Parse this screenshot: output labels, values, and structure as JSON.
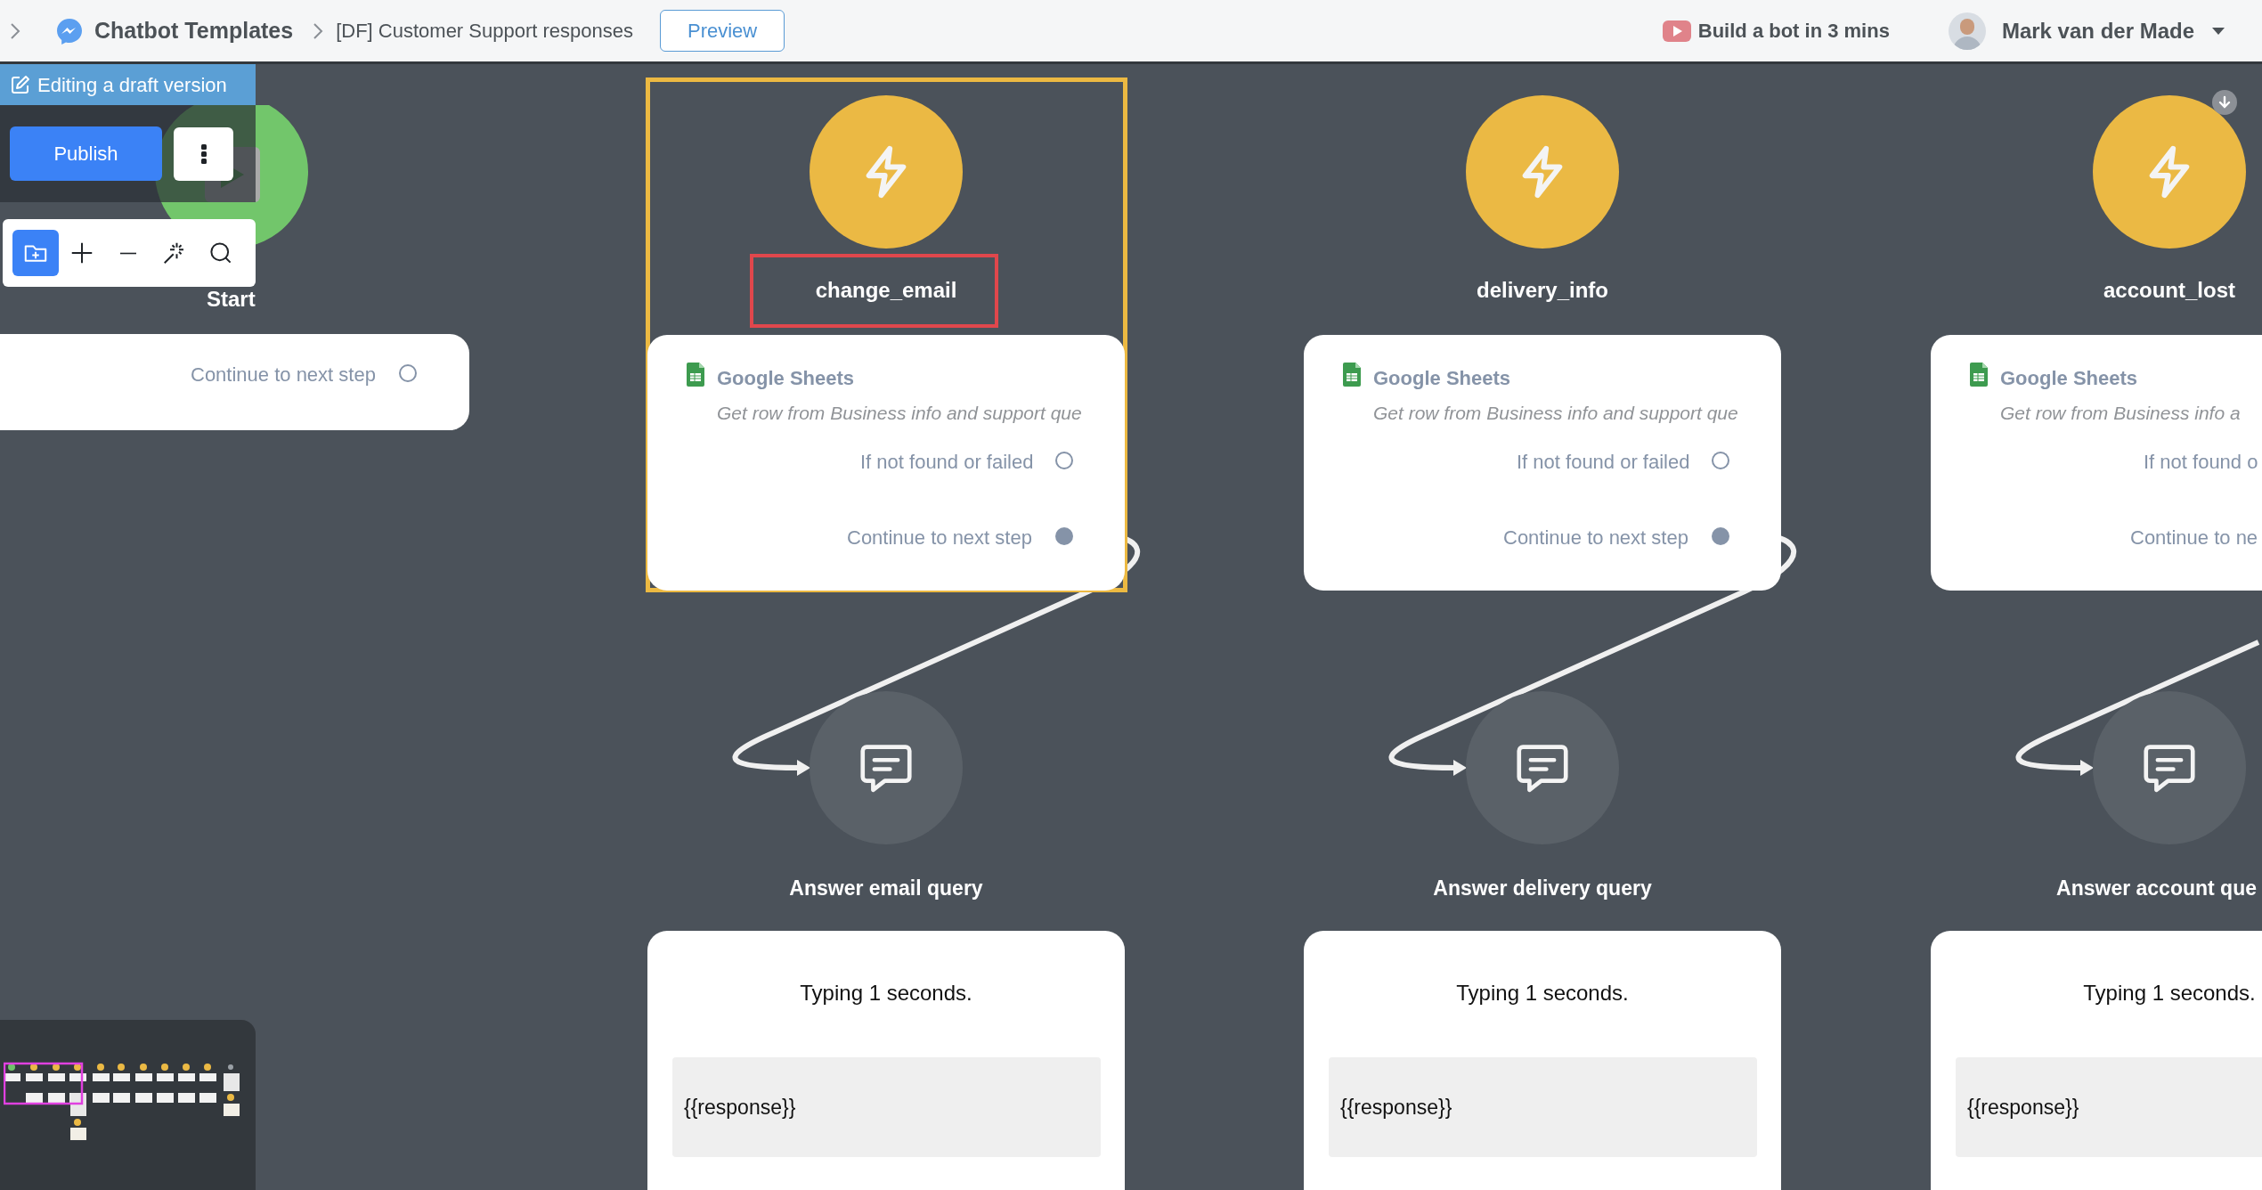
{
  "breadcrumb": [
    {
      "text": "Chatbot Templates"
    },
    {
      "text": "[DF] Customer Support responses"
    }
  ],
  "preview_button": "Preview",
  "tutorial_link": "Build a bot in 3 mins",
  "user": {
    "name": "Mark van der Made"
  },
  "draft_banner": "Editing a draft version",
  "publish_button": "Publish",
  "toolbar": [
    {
      "kind": "add-folder",
      "selected": true
    },
    {
      "kind": "zoom-in",
      "selected": false
    },
    {
      "kind": "zoom-out",
      "selected": false
    },
    {
      "kind": "auto-arrange",
      "selected": false
    },
    {
      "kind": "search",
      "selected": false
    }
  ],
  "start_node": {
    "title": "Start",
    "outputs": [
      {
        "label": "Continue to next step",
        "connected": false
      }
    ]
  },
  "flows": [
    {
      "selected": true,
      "trigger": {
        "title": "change_email",
        "highlighted": true
      },
      "action": {
        "service": "Google Sheets",
        "description": "Get row from Business info and support que",
        "outputs": [
          {
            "label": "If not found or failed",
            "connected": false
          },
          {
            "label": "Continue to next step",
            "connected": true
          }
        ]
      },
      "message": {
        "title": "Answer email query",
        "typing": "Typing 1 seconds.",
        "text": "{{response}}"
      }
    },
    {
      "selected": false,
      "trigger": {
        "title": "delivery_info",
        "highlighted": false
      },
      "action": {
        "service": "Google Sheets",
        "description": "Get row from Business info and support que",
        "outputs": [
          {
            "label": "If not found or failed",
            "connected": false
          },
          {
            "label": "Continue to next step",
            "connected": true
          }
        ]
      },
      "message": {
        "title": "Answer delivery query",
        "typing": "Typing 1 seconds.",
        "text": "{{response}}"
      }
    },
    {
      "selected": false,
      "trigger": {
        "title": "account_lost",
        "highlighted": false
      },
      "action": {
        "service": "Google Sheets",
        "description": "Get row from Business info a",
        "outputs": [
          {
            "label": "If not found o"
          },
          {
            "label": "Continue to ne"
          }
        ]
      },
      "message": {
        "title": "Answer account que",
        "typing": "Typing 1 seconds.",
        "text": "{{response}}"
      }
    }
  ]
}
